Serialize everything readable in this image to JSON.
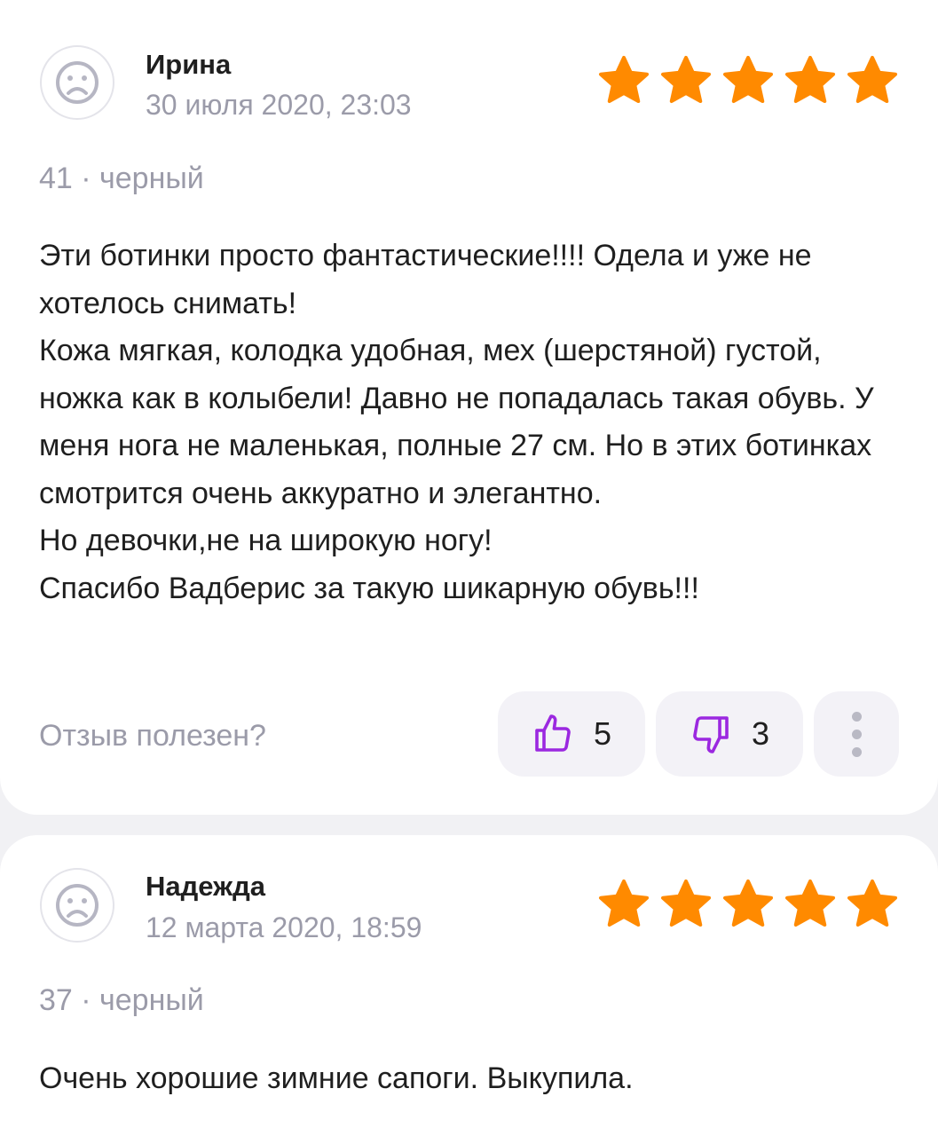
{
  "reviews": [
    {
      "author": "Ирина",
      "date": "30 июля 2020, 23:03",
      "rating": 5,
      "variant": "41 · черный",
      "text_lines": [
        "Эти ботинки просто фантастические!!!! Одела и уже не хотелось снимать!",
        "Кожа мягкая, колодка удобная, мех (шерстяной) густой, ножка как в колыбели! Давно не попадалась такая обувь. У меня нога не маленькая, полные 27 см. Но в этих ботинках смотрится очень аккуратно и элегантно.",
        "Но девочки,не на широкую ногу!",
        "Спасибо Вадберис за такую шикарную обувь!!!"
      ],
      "helpful_label": "Отзыв полезен?",
      "likes": "5",
      "dislikes": "3"
    },
    {
      "author": "Надежда",
      "date": "12 марта 2020, 18:59",
      "rating": 5,
      "variant": "37 · черный",
      "text_lines": [
        "Очень хорошие зимние сапоги. Выкупила."
      ]
    }
  ],
  "colors": {
    "star": "#ff8a00",
    "accent": "#9b28e0",
    "muted_text": "#9b9ba9",
    "background": "#f1f1f4"
  },
  "icons": {
    "avatar": "sad-face-icon",
    "star": "star-icon",
    "like": "thumbs-up-icon",
    "dislike": "thumbs-down-icon",
    "more": "more-vertical-icon"
  }
}
